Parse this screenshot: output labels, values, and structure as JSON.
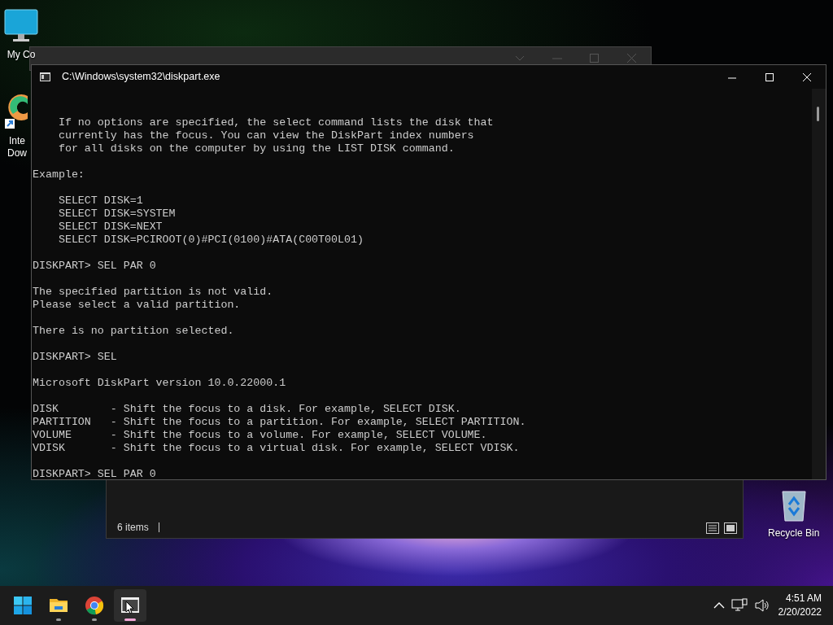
{
  "desktop_icons": [
    {
      "kind": "monitor",
      "lines": [
        "My Co"
      ]
    },
    {
      "kind": "app",
      "lines": [
        "Inte",
        "Dow"
      ]
    },
    {
      "kind": "recycle",
      "lines": [
        "Recycle Bin"
      ]
    }
  ],
  "console_window": {
    "title": "C:\\Windows\\system32\\diskpart.exe",
    "paragraphs": [
      [
        "    If no options are specified, the select command lists the disk that",
        "    currently has the focus. You can view the DiskPart index numbers",
        "    for all disks on the computer by using the LIST DISK command."
      ],
      [
        "Example:"
      ],
      [
        "    SELECT DISK=1",
        "    SELECT DISK=SYSTEM",
        "    SELECT DISK=NEXT",
        "    SELECT DISK=PCIROOT(0)#PCI(0100)#ATA(C00T00L01)"
      ],
      [
        "DISKPART> SEL PAR 0"
      ],
      [
        "The specified partition is not valid.",
        "Please select a valid partition."
      ],
      [
        "There is no partition selected."
      ],
      [
        "DISKPART> SEL"
      ],
      [
        "Microsoft DiskPart version 10.0.22000.1"
      ],
      [
        "DISK        - Shift the focus to a disk. For example, SELECT DISK.",
        "PARTITION   - Shift the focus to a partition. For example, SELECT PARTITION.",
        "VOLUME      - Shift the focus to a volume. For example, SELECT VOLUME.",
        "VDISK       - Shift the focus to a virtual disk. For example, SELECT VDISK."
      ],
      [
        "DISKPART> SEL PAR 0"
      ]
    ]
  },
  "explorer_window": {
    "status": "6 items"
  },
  "taskbar": {
    "apps": [
      {
        "kind": "folder",
        "active": false
      },
      {
        "kind": "browser",
        "active": false
      },
      {
        "kind": "terminal",
        "active": true
      }
    ],
    "time": "4:51 AM",
    "date": "2/20/2022"
  }
}
